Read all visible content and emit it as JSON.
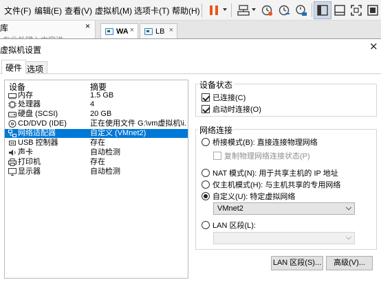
{
  "menubar": {
    "items": [
      {
        "label": "文件(F)"
      },
      {
        "label": "编辑(E)"
      },
      {
        "label": "查看(V)"
      },
      {
        "label": "虚拟机(M)"
      },
      {
        "label": "选项卡(T)"
      },
      {
        "label": "帮助(H)"
      }
    ]
  },
  "toolbar": {
    "icons": [
      "pause-icon",
      "send-keys-icon",
      "snapshot-icon",
      "revert-snapshot-icon",
      "snapshot-manager-icon",
      "sidebar-view-icon",
      "console-view-icon",
      "fullscreen-icon",
      "unity-icon"
    ],
    "colors": {
      "pause": "#e8561c",
      "accent": "#1e6fbf"
    }
  },
  "library": {
    "title": "库",
    "close": "×",
    "search_placeholder": "在此处键入内容进"
  },
  "vm_tabs": [
    {
      "label": "WA",
      "active": true,
      "close": "×"
    },
    {
      "label": "LB",
      "active": false,
      "close": "×"
    }
  ],
  "dialog": {
    "title": "虚拟机设置",
    "close": "✕",
    "tabs": [
      {
        "label": "硬件",
        "active": true
      },
      {
        "label": "选项",
        "active": false
      }
    ]
  },
  "device_table": {
    "headers": {
      "device": "设备",
      "summary": "摘要"
    },
    "rows": [
      {
        "name": "内存",
        "summary": "1.5 GB",
        "icon": "memory-icon"
      },
      {
        "name": "处理器",
        "summary": "4",
        "icon": "processor-icon"
      },
      {
        "name": "硬盘 (SCSI)",
        "summary": "20 GB",
        "icon": "hard-disk-icon"
      },
      {
        "name": "CD/DVD (IDE)",
        "summary": "正在使用文件 G:\\vm虚拟机\\i...",
        "icon": "cd-dvd-icon"
      },
      {
        "name": "网络适配器",
        "summary": "自定义 (VMnet2)",
        "icon": "network-adapter-icon",
        "selected": true
      },
      {
        "name": "USB 控制器",
        "summary": "存在",
        "icon": "usb-controller-icon"
      },
      {
        "name": "声卡",
        "summary": "自动检测",
        "icon": "sound-card-icon"
      },
      {
        "name": "打印机",
        "summary": "存在",
        "icon": "printer-icon"
      },
      {
        "name": "显示器",
        "summary": "自动检测",
        "icon": "display-icon"
      }
    ]
  },
  "device_status": {
    "legend": "设备状态",
    "connected": {
      "label": "已连接(C)",
      "checked": true
    },
    "connect_at_power_on": {
      "label": "启动时连接(O)",
      "checked": true
    }
  },
  "network_connection": {
    "legend": "网络连接",
    "bridged": {
      "label": "桥接模式(B): 直接连接物理网络",
      "checked": false
    },
    "replicate_state": {
      "label": "复制物理网络连接状态(P)",
      "checked": false,
      "disabled": true
    },
    "nat": {
      "label": "NAT 模式(N): 用于共享主机的 IP 地址",
      "checked": false
    },
    "host_only": {
      "label": "仅主机模式(H): 与主机共享的专用网络",
      "checked": false
    },
    "custom": {
      "label": "自定义(U): 特定虚拟网络",
      "checked": true
    },
    "custom_network": {
      "value": "VMnet2"
    },
    "lan_segment": {
      "label": "LAN 区段(L):",
      "checked": false
    },
    "lan_segment_select": {
      "value": "",
      "disabled": true
    }
  },
  "buttons": {
    "lan_segments": "LAN 区段(S)...",
    "advanced": "高级(V)..."
  }
}
